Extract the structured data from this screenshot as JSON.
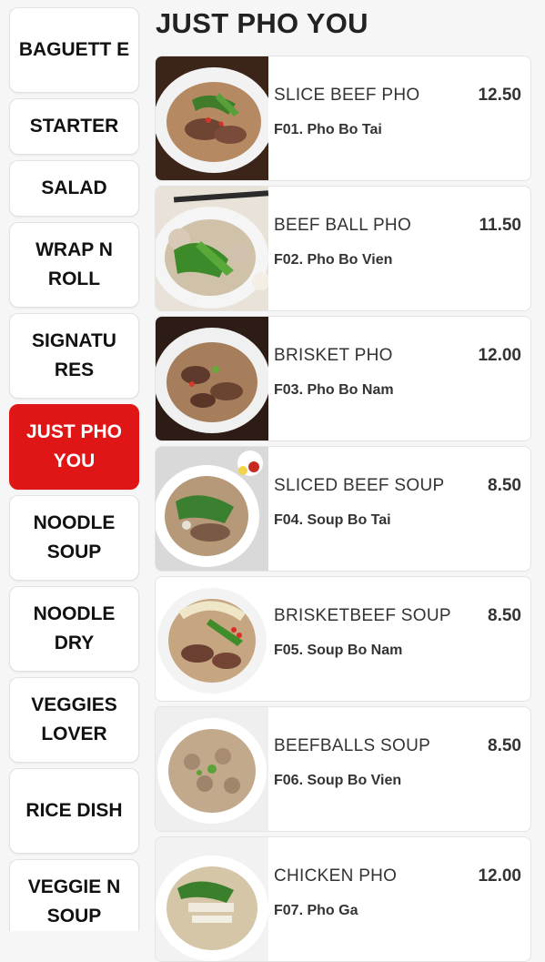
{
  "sidebar": {
    "categories": [
      {
        "label": "BAGUETT E",
        "active": false
      },
      {
        "label": "STARTER",
        "active": false
      },
      {
        "label": "SALAD",
        "active": false
      },
      {
        "label": "WRAP N ROLL",
        "active": false
      },
      {
        "label": "SIGNATU RES",
        "active": false
      },
      {
        "label": "JUST PHO YOU",
        "active": true
      },
      {
        "label": "NOODLE SOUP",
        "active": false
      },
      {
        "label": "NOODLE DRY",
        "active": false
      },
      {
        "label": "VEGGIES LOVER",
        "active": false
      },
      {
        "label": "RICE DISH",
        "active": false
      },
      {
        "label": "VEGGIE N SOUP",
        "active": false
      }
    ]
  },
  "section": {
    "title": "JUST PHO YOU"
  },
  "menu_items": [
    {
      "name": "SLICE BEEF PHO",
      "price": "12.50",
      "code": "F01. Pho Bo Tai"
    },
    {
      "name": "BEEF BALL PHO",
      "price": "11.50",
      "code": "F02. Pho Bo Vien"
    },
    {
      "name": "BRISKET PHO",
      "price": "12.00",
      "code": "F03. Pho Bo Nam"
    },
    {
      "name": "SLICED BEEF SOUP",
      "price": "8.50",
      "code": "F04. Soup Bo Tai"
    },
    {
      "name": "BRISKETBEEF SOUP",
      "price": "8.50",
      "code": "F05. Soup Bo Nam"
    },
    {
      "name": "BEEFBALLS SOUP",
      "price": "8.50",
      "code": "F06. Soup Bo Vien"
    },
    {
      "name": "CHICKEN PHO",
      "price": "12.00",
      "code": "F07. Pho Ga"
    }
  ],
  "colors": {
    "accent": "#e01616"
  }
}
